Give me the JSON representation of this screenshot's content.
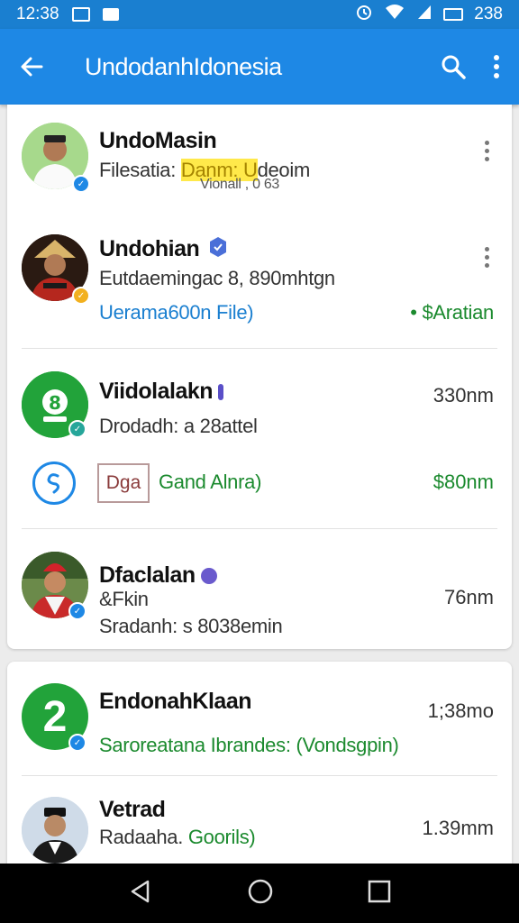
{
  "status_bar": {
    "time": "12:38",
    "battery_time": "238"
  },
  "app_bar": {
    "title": "UndodanhIdonesia"
  },
  "card1": {
    "rows": [
      {
        "name": "UndoMasin",
        "sub_prefix": "Filesatia: ",
        "sub_highlight": "Danm: U",
        "sub_suffix": "deoim",
        "sub_faint": "Vionall  ,  0  63"
      },
      {
        "name": "Undohian",
        "sub": "Eutdaemingac 8, 890mhtgn",
        "link": "Uerama600n File)",
        "status": "• $Aratian"
      },
      {
        "name": "Viidolalakn",
        "time": "330nm",
        "sub": "Drodadh: a 28attel",
        "chip": "Dga",
        "chip_label": "Gand Alnra)",
        "amount": "$80nm"
      },
      {
        "name": "Dfaclalan",
        "line2": "&Fkin",
        "sub": "Sradanh: s 8038emin",
        "time": "76nm"
      }
    ]
  },
  "card2": {
    "rows": [
      {
        "avatar_text": "2",
        "name": "EndonahKlaan",
        "sub": "Saroreatana Ibrandes: (Vondsgpin)",
        "time": "1;38mo"
      },
      {
        "name": "Vetrad",
        "sub_prefix": "Radaaha. ",
        "sub_link": "Goorils)",
        "time": "1.39mm"
      }
    ]
  },
  "colors": {
    "app_bar": "#1e88e5",
    "status_bar": "#1a7fd0",
    "accent_green": "#1b8a2e",
    "accent_blue": "#1a7fd0"
  }
}
